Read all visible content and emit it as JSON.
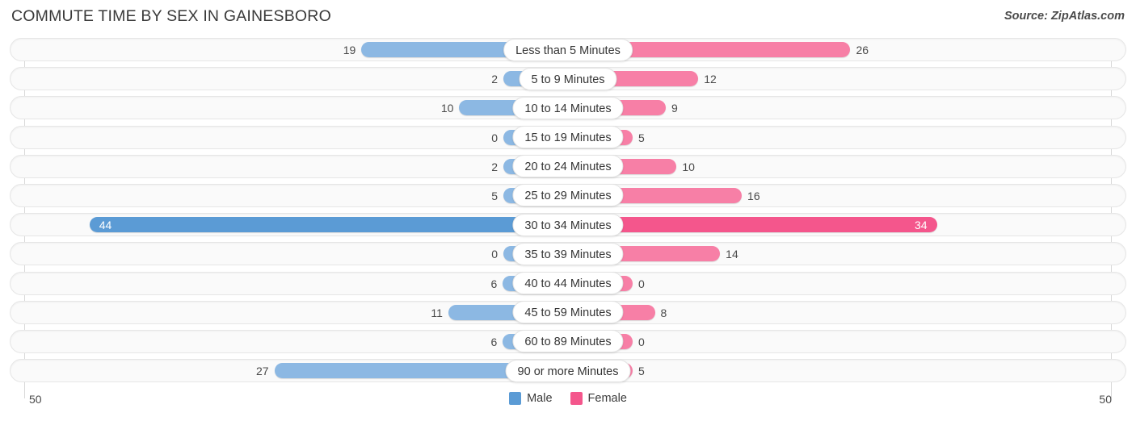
{
  "header": {
    "title": "COMMUTE TIME BY SEX IN GAINESBORO",
    "source": "Source: ZipAtlas.com"
  },
  "axis": {
    "left_max_label": "50",
    "right_max_label": "50",
    "max": 50
  },
  "legend": {
    "items": [
      {
        "label": "Male",
        "color": "#5b9bd5"
      },
      {
        "label": "Female",
        "color": "#f4568c"
      }
    ]
  },
  "colors": {
    "male": "#8cb8e3",
    "female": "#f77fa6",
    "male_peak": "#5b9bd5",
    "female_peak": "#f4568c",
    "track": "#fafafa",
    "gridline": "#d8d8d8"
  },
  "chart_data": {
    "type": "bar",
    "orientation": "horizontal-diverging",
    "title": "COMMUTE TIME BY SEX IN GAINESBORO",
    "xlabel": "",
    "ylabel": "",
    "xlim": [
      50,
      50
    ],
    "grid": true,
    "legend_position": "bottom-center",
    "categories": [
      "Less than 5 Minutes",
      "5 to 9 Minutes",
      "10 to 14 Minutes",
      "15 to 19 Minutes",
      "20 to 24 Minutes",
      "25 to 29 Minutes",
      "30 to 34 Minutes",
      "35 to 39 Minutes",
      "40 to 44 Minutes",
      "45 to 59 Minutes",
      "60 to 89 Minutes",
      "90 or more Minutes"
    ],
    "series": [
      {
        "name": "Male",
        "side": "left",
        "values": [
          19,
          2,
          10,
          0,
          2,
          5,
          44,
          0,
          6,
          11,
          6,
          27
        ]
      },
      {
        "name": "Female",
        "side": "right",
        "values": [
          26,
          12,
          9,
          5,
          10,
          16,
          34,
          14,
          0,
          8,
          0,
          5
        ]
      }
    ]
  },
  "rows": [
    {
      "category": "Less than 5 Minutes",
      "male": "19",
      "female": "26",
      "male_val": 19,
      "female_val": 26
    },
    {
      "category": "5 to 9 Minutes",
      "male": "2",
      "female": "12",
      "male_val": 2,
      "female_val": 12
    },
    {
      "category": "10 to 14 Minutes",
      "male": "10",
      "female": "9",
      "male_val": 10,
      "female_val": 9
    },
    {
      "category": "15 to 19 Minutes",
      "male": "0",
      "female": "5",
      "male_val": 0,
      "female_val": 5
    },
    {
      "category": "20 to 24 Minutes",
      "male": "2",
      "female": "10",
      "male_val": 2,
      "female_val": 10
    },
    {
      "category": "25 to 29 Minutes",
      "male": "5",
      "female": "16",
      "male_val": 5,
      "female_val": 16
    },
    {
      "category": "30 to 34 Minutes",
      "male": "44",
      "female": "34",
      "male_val": 44,
      "female_val": 34
    },
    {
      "category": "35 to 39 Minutes",
      "male": "0",
      "female": "14",
      "male_val": 0,
      "female_val": 14
    },
    {
      "category": "40 to 44 Minutes",
      "male": "6",
      "female": "0",
      "male_val": 6,
      "female_val": 0
    },
    {
      "category": "45 to 59 Minutes",
      "male": "11",
      "female": "8",
      "male_val": 11,
      "female_val": 8
    },
    {
      "category": "60 to 89 Minutes",
      "male": "6",
      "female": "0",
      "male_val": 6,
      "female_val": 0
    },
    {
      "category": "90 or more Minutes",
      "male": "27",
      "female": "5",
      "male_val": 27,
      "female_val": 5
    }
  ]
}
